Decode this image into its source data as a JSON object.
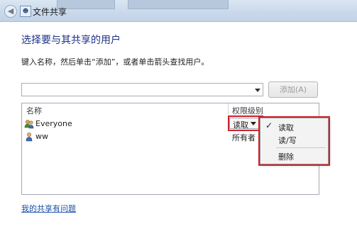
{
  "window": {
    "title": "文件共享"
  },
  "main": {
    "heading": "选择要与其共享的用户",
    "instruction": "键入名称，然后单击“添加”，或者单击箭头查找用户。",
    "name_input": {
      "value": "",
      "placeholder": ""
    },
    "add_button_label": "添加(A)"
  },
  "user_list": {
    "columns": [
      "名称",
      "权限级别"
    ],
    "rows": [
      {
        "name": "Everyone",
        "permission": "读取",
        "icon": "group-users-icon"
      },
      {
        "name": "ww",
        "permission": "所有者",
        "icon": "user-icon"
      }
    ]
  },
  "permission_menu": {
    "items": [
      "读取",
      "读/写",
      "删除"
    ],
    "checked_item": "读取",
    "check_mark": "✓"
  },
  "help_link": "我的共享有问题",
  "colors": {
    "heading": "#1e3287",
    "link": "#1a4fa8",
    "highlight_box": "#c8232c"
  }
}
